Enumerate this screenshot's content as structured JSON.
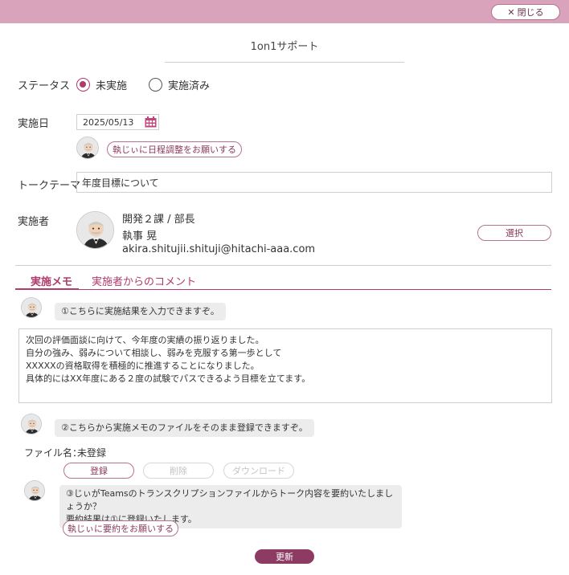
{
  "header": {
    "close_label": "閉じる",
    "close_icon": "close-icon"
  },
  "title": "1on1サポート",
  "status": {
    "label": "ステータス",
    "options": [
      "未実施",
      "実施済み"
    ],
    "selected": "未実施"
  },
  "date": {
    "label": "実施日",
    "value": "2025/05/13",
    "request_label": "執じぃに日程調整をお願いする"
  },
  "topic": {
    "label": "トークテーマ",
    "value": "年度目標について"
  },
  "performer": {
    "label": "実施者",
    "department": "開発２課 / 部長",
    "name": "執事 晃",
    "email": "akira.shitujii.shituji@hitachi-aaa.com",
    "select_label": "選択"
  },
  "tabs": [
    {
      "label": "実施メモ",
      "active": true
    },
    {
      "label": "実施者からのコメント",
      "active": false
    }
  ],
  "memo": {
    "hint": "①こちらに実施結果を入力できますぞ。",
    "lines": [
      "次回の評価面談に向けて、今年度の実績の振り返りました。",
      "自分の強み、弱みについて相談し、弱みを克服する第一歩として",
      "XXXXXの資格取得を積極的に推進することになりました。",
      "具体的にはXX年度にある２度の試験でパスできるよう目標を立てます。"
    ]
  },
  "file": {
    "hint": "②こちらから実施メモのファイルをそのまま登録できますぞ。",
    "label": "ファイル名：",
    "value": "未登録",
    "register_label": "登録",
    "delete_label": "削除",
    "download_label": "ダウンロード"
  },
  "summary": {
    "hint_line1": "③じぃがTeamsのトランスクリプションファイルからトーク内容を要約いたしましょうか？",
    "hint_line2": "要約結果は①に登録いたします。",
    "request_label": "執じぃに要約をお願いする"
  },
  "update_label": "更新",
  "colors": {
    "accent": "#b03a6a",
    "topbar": "#d9a3bb",
    "button_dark": "#8e3b64"
  }
}
